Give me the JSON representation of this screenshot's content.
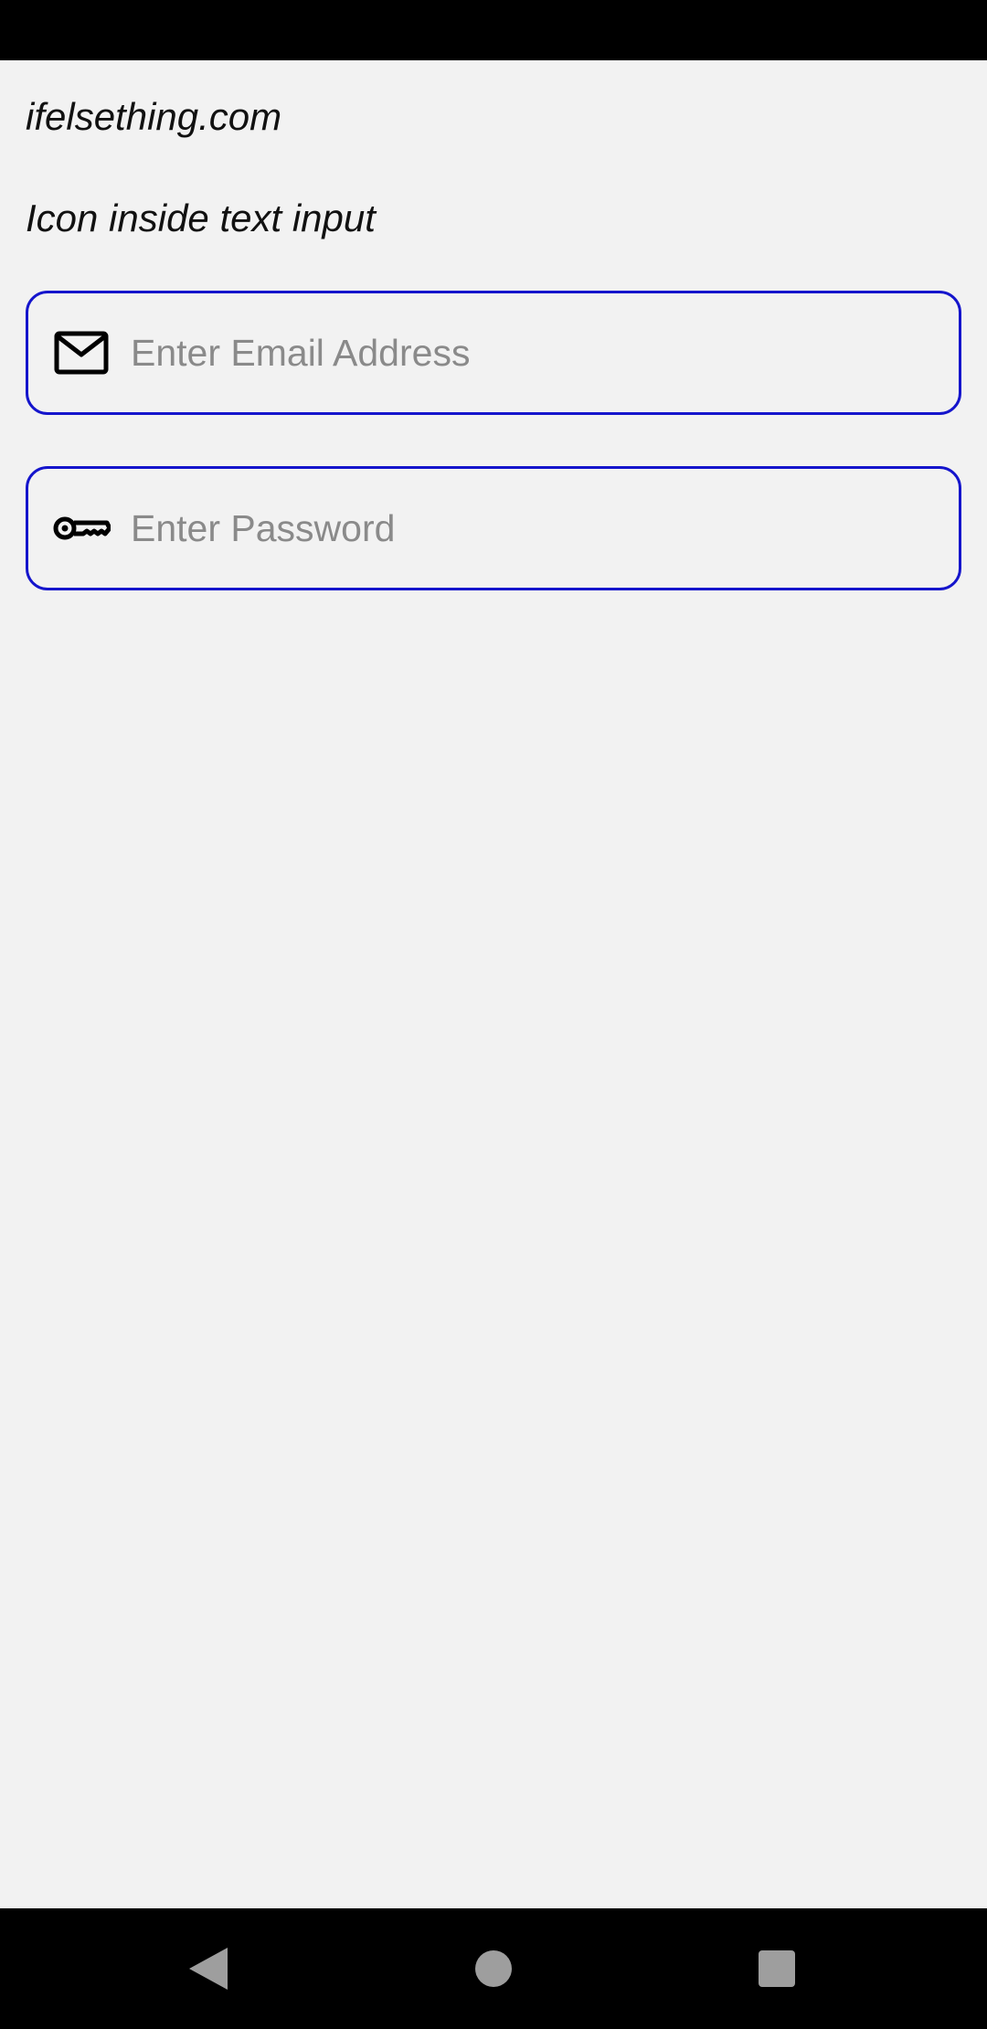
{
  "header": {
    "site_label": "ifelsething.com",
    "subtitle": "Icon inside text input"
  },
  "form": {
    "email": {
      "icon": "mail-icon",
      "placeholder": "Enter Email Address",
      "value": ""
    },
    "password": {
      "icon": "key-icon",
      "placeholder": "Enter Password",
      "value": ""
    }
  },
  "navigation": {
    "back_icon": "triangle-back-icon",
    "home_icon": "circle-home-icon",
    "recents_icon": "square-recents-icon"
  },
  "colors": {
    "field_border": "#1515cc",
    "background": "#f2f2f2",
    "system_bars": "#000000",
    "nav_icons": "#9e9e9e"
  }
}
